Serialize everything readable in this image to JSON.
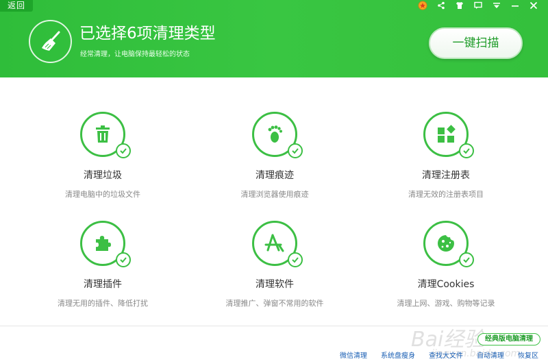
{
  "header": {
    "back_label": "返回",
    "title": "已选择6项清理类型",
    "subtitle": "经常清理，让电脑保持最轻松的状态",
    "scan_button": "一键扫描"
  },
  "top_icons": [
    "medal-icon",
    "share-icon",
    "shirt-icon",
    "message-icon",
    "menu-icon",
    "minimize-icon",
    "close-icon"
  ],
  "items": [
    {
      "label": "清理垃圾",
      "desc": "清理电脑中的垃圾文件",
      "icon": "trash-icon"
    },
    {
      "label": "清理痕迹",
      "desc": "清理浏览器使用痕迹",
      "icon": "footprint-icon"
    },
    {
      "label": "清理注册表",
      "desc": "清理无效的注册表项目",
      "icon": "registry-icon"
    },
    {
      "label": "清理插件",
      "desc": "清理无用的插件、降低打扰",
      "icon": "puzzle-icon"
    },
    {
      "label": "清理软件",
      "desc": "清理推广、弹窗不常用的软件",
      "icon": "appstore-icon"
    },
    {
      "label": "清理Cookies",
      "desc": "清理上网、游戏、购物等记录",
      "icon": "cookie-icon"
    }
  ],
  "footer": {
    "classic_button": "经典版电脑清理",
    "links": [
      "微信清理",
      "系统盘瘦身",
      "查找大文件",
      "自动清理",
      "恢复区"
    ]
  },
  "watermark": {
    "main": "Bai经验",
    "sub": "jingyan.baidu.com"
  },
  "colors": {
    "accent": "#3cbf44",
    "header": "#34c03c",
    "link": "#1a5fb4"
  }
}
